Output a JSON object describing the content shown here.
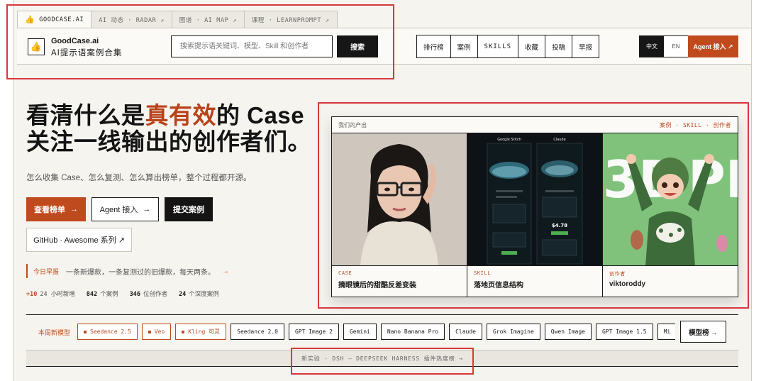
{
  "top_tabs": [
    {
      "icon": "👍",
      "label": "GOODCASE.AI"
    },
    {
      "label": "AI 动态 · RADAR ↗"
    },
    {
      "label": "图谱 · AI MAP ↗"
    },
    {
      "label": "课程 · LEARNPROMPT ↗"
    }
  ],
  "header": {
    "logo_icon": "👍",
    "brand_name": "GoodCase.ai",
    "brand_sub": "AI提示语案例合集",
    "search_placeholder": "搜索提示语关键词、模型、Skill 和创作者",
    "search_button": "搜索",
    "nav": [
      "排行榜",
      "案例",
      "SKILLS",
      "收藏",
      "投稿",
      "早报"
    ],
    "lang_active": "中文",
    "lang_other": "EN",
    "agent_button": "Agent 接入 ↗"
  },
  "hero": {
    "title_pre": "看清什么是",
    "title_accent": "真有效",
    "title_post": "的 Case",
    "title_line2": "关注一线输出的创作者们。",
    "subtitle": "怎么收集 Case、怎么复测、怎么算出榜单，整个过程都开源。",
    "btn_primary": "查看榜单",
    "btn_primary_arrow": "→",
    "btn_agent": "Agent 接入",
    "btn_agent_arrow": "→",
    "btn_submit": "提交案例",
    "btn_github": "GitHub · Awesome 系列 ↗"
  },
  "daily": {
    "tag": "今日早报",
    "text": "一条新爆款，一条复测过的旧爆款，每天两条。",
    "arrow": "→"
  },
  "stats": [
    {
      "num": "+10",
      "label": "24 小时新增"
    },
    {
      "num": "842",
      "label": "个案例"
    },
    {
      "num": "346",
      "label": "位创作者"
    },
    {
      "num": "24",
      "label": "个深度案例"
    }
  ],
  "panel": {
    "head_left": "我们的产出",
    "head_right": "案例 · SKILL · 创作者",
    "cards": [
      {
        "type": "CASE",
        "title": "摘眼镜后的甜酷反差变装"
      },
      {
        "type": "SKILL",
        "title": "落地页信息结构",
        "screen_labels": [
          "Google Stitch",
          "Claude"
        ],
        "price": "$4.78"
      },
      {
        "type": "创作者",
        "title": "viktoroddy"
      }
    ]
  },
  "models": {
    "label": "本周新模型",
    "hot": [
      "Seedance 2.5",
      "Veo",
      "Kling 可灵"
    ],
    "chips": [
      "Seedance 2.0",
      "GPT Image 2",
      "Gemini",
      "Nano Banana Pro",
      "Claude",
      "Grok Imagine",
      "Qwen Image",
      "GPT Image 1.5",
      "Mi"
    ],
    "rank_button": "模型榜 →"
  },
  "experiment": "新实验 · DSH — DEEPSEEK HARNESS 插件热度榜 →",
  "colors": {
    "accent": "#bf4a1e",
    "dark": "#161616",
    "annotation": "#d9373a"
  }
}
